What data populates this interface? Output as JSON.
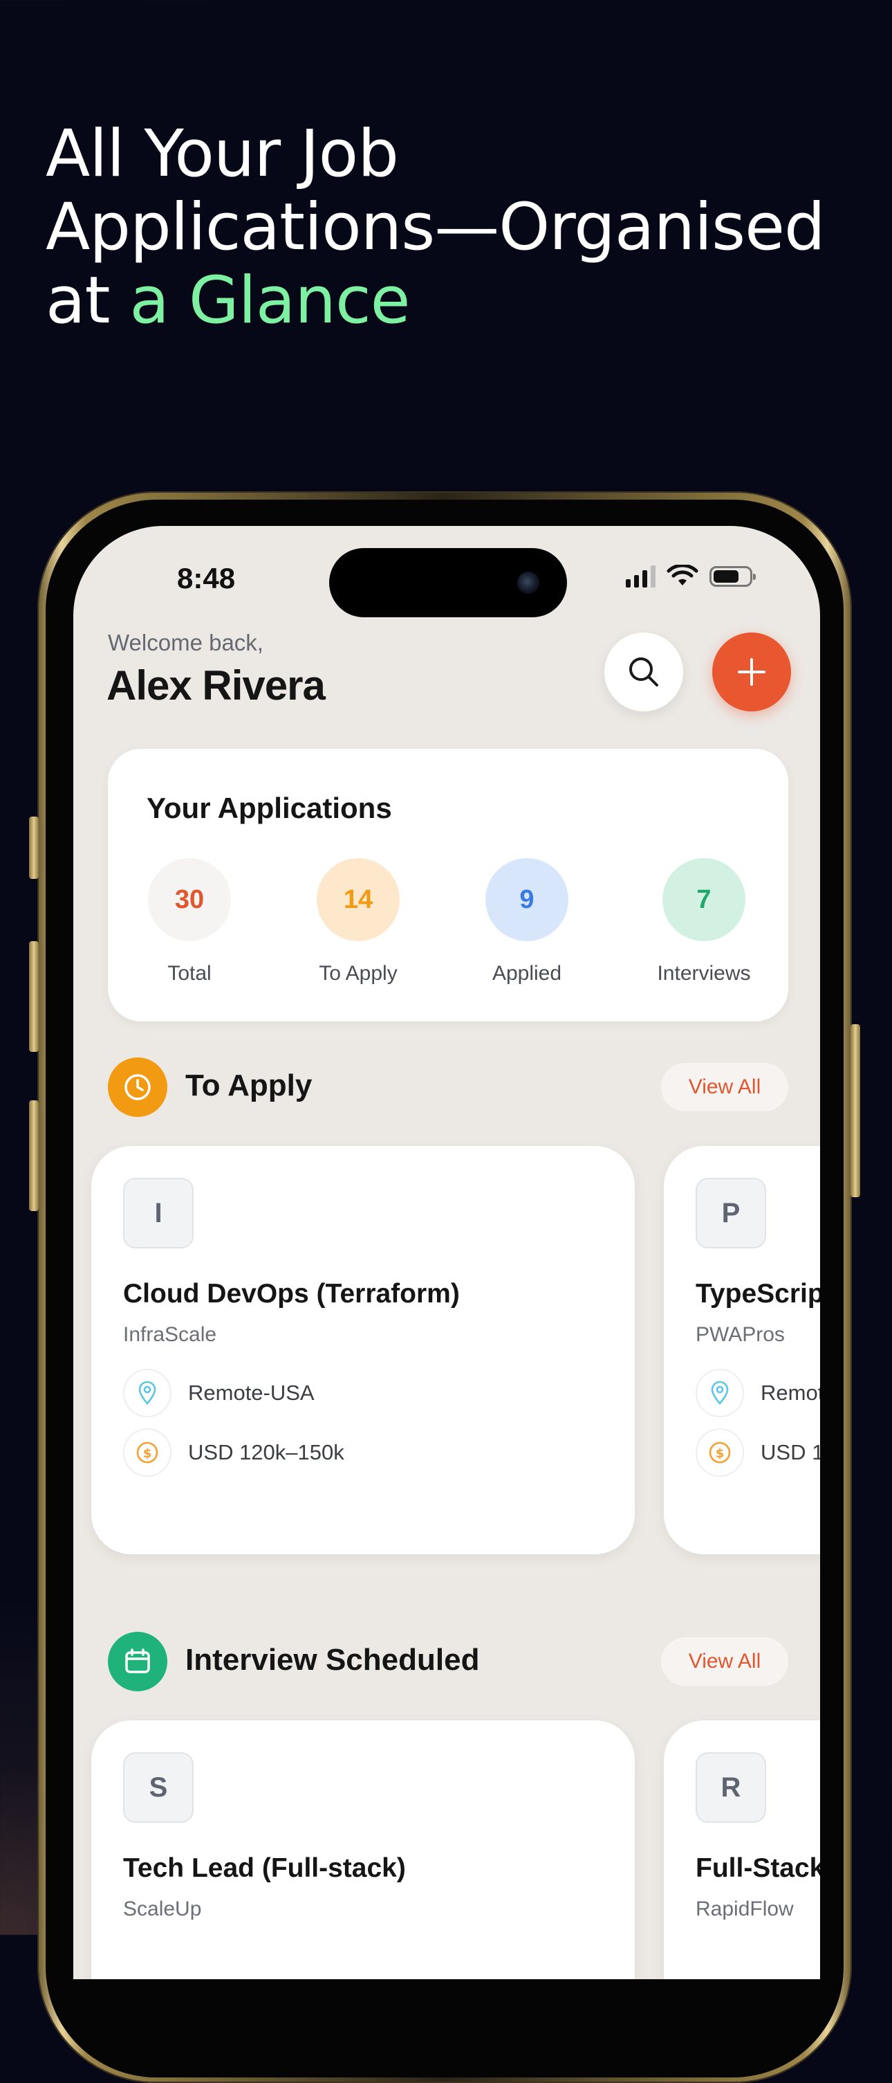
{
  "headline": {
    "line1": "All Your Job",
    "line2": "Applications—Organised",
    "line3_prefix": "at ",
    "line3_accent": "a Glance"
  },
  "status_bar": {
    "time": "8:48"
  },
  "header": {
    "welcome": "Welcome back,",
    "user_name": "Alex Rivera"
  },
  "stats": {
    "title": "Your Applications",
    "items": [
      {
        "value": "30",
        "label": "Total",
        "color": "#e0572f",
        "bg": "#f6f4f2"
      },
      {
        "value": "14",
        "label": "To Apply",
        "color": "#f29a12",
        "bg": "#fde8cc"
      },
      {
        "value": "9",
        "label": "Applied",
        "color": "#3a7be0",
        "bg": "#d8e6fb"
      },
      {
        "value": "7",
        "label": "Interviews",
        "color": "#1fa86b",
        "bg": "#d3f1e3"
      }
    ]
  },
  "sections": {
    "to_apply": {
      "title": "To Apply",
      "view_all": "View All",
      "icon": "clock-icon",
      "icon_color": "#f29a12",
      "cards": [
        {
          "logo": "I",
          "title": "Cloud DevOps (Terraform)",
          "company": "InfraScale",
          "location": "Remote-USA",
          "salary": "USD 120k–150k"
        },
        {
          "logo": "P",
          "title": "TypeScrip",
          "company": "PWAPros",
          "location": "Remot",
          "salary": "USD 1("
        }
      ]
    },
    "interview": {
      "title": "Interview Scheduled",
      "view_all": "View All",
      "icon": "calendar-icon",
      "icon_color": "#1fb27a",
      "cards": [
        {
          "logo": "S",
          "title": "Tech Lead (Full-stack)",
          "company": "ScaleUp"
        },
        {
          "logo": "R",
          "title": "Full-Stack",
          "company": "RapidFlow"
        }
      ]
    }
  },
  "theme": {
    "accent": "#e8572f",
    "headline_accent": "#7ef0a2"
  }
}
